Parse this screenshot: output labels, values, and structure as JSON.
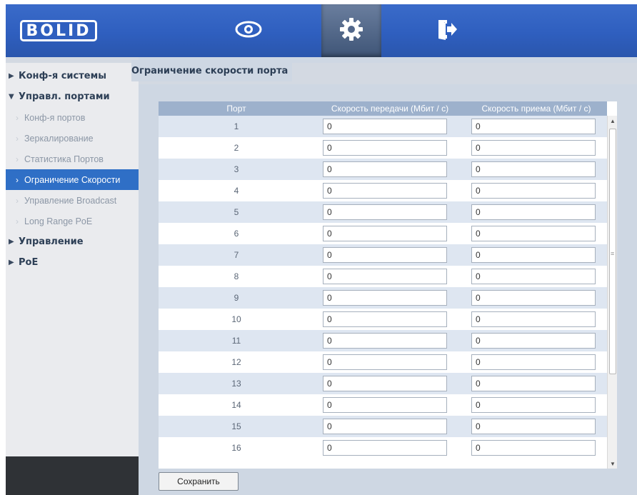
{
  "header": {
    "logo_text": "BOLID",
    "nav": [
      {
        "name": "view",
        "icon": "eye-icon"
      },
      {
        "name": "settings",
        "icon": "gear-icon",
        "active": true
      },
      {
        "name": "logout",
        "icon": "exit-door-icon"
      }
    ]
  },
  "sidebar": {
    "groups": [
      {
        "label": "Конф-я системы",
        "expanded": false
      },
      {
        "label": "Управл. портами",
        "expanded": true
      },
      {
        "label": "Управление",
        "expanded": false
      },
      {
        "label": "PoE",
        "expanded": false
      }
    ],
    "items": [
      {
        "label": "Конф-я портов"
      },
      {
        "label": "Зеркалирование"
      },
      {
        "label": "Статистика Портов"
      },
      {
        "label": "Ограничение Скорости",
        "active": true
      },
      {
        "label": "Управление Broadcast"
      },
      {
        "label": "Long Range PoE"
      }
    ]
  },
  "main": {
    "title": "Ограничение скорости порта",
    "columns": [
      "Порт",
      "Скорость передачи (Мбит / с)",
      "Скорость приема (Мбит / с)"
    ],
    "rows": [
      {
        "port": "1",
        "tx": "0",
        "rx": "0"
      },
      {
        "port": "2",
        "tx": "0",
        "rx": "0"
      },
      {
        "port": "3",
        "tx": "0",
        "rx": "0"
      },
      {
        "port": "4",
        "tx": "0",
        "rx": "0"
      },
      {
        "port": "5",
        "tx": "0",
        "rx": "0"
      },
      {
        "port": "6",
        "tx": "0",
        "rx": "0"
      },
      {
        "port": "7",
        "tx": "0",
        "rx": "0"
      },
      {
        "port": "8",
        "tx": "0",
        "rx": "0"
      },
      {
        "port": "9",
        "tx": "0",
        "rx": "0"
      },
      {
        "port": "10",
        "tx": "0",
        "rx": "0"
      },
      {
        "port": "11",
        "tx": "0",
        "rx": "0"
      },
      {
        "port": "12",
        "tx": "0",
        "rx": "0"
      },
      {
        "port": "13",
        "tx": "0",
        "rx": "0"
      },
      {
        "port": "14",
        "tx": "0",
        "rx": "0"
      },
      {
        "port": "15",
        "tx": "0",
        "rx": "0"
      },
      {
        "port": "16",
        "tx": "0",
        "rx": "0"
      }
    ],
    "save_label": "Сохранить"
  },
  "colors": {
    "header_blue": "#2f5fbf",
    "active_item": "#2f6fc6",
    "table_header": "#9db1cc",
    "row_alt": "#dee6f1",
    "content_bg": "#ced7e3"
  }
}
